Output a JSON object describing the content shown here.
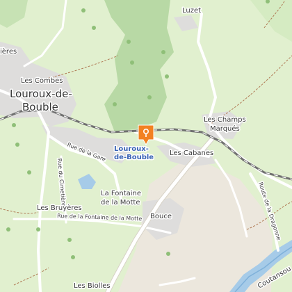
{
  "map": {
    "colors": {
      "meadow": "#e1f0cf",
      "forest": "#b8d9a5",
      "residential": "#e0dfdf",
      "bare": "#ebe6dc",
      "water": "#a6cbe8",
      "rail": "#707070",
      "road": "#ffffff",
      "marker": "#f28122"
    },
    "labels": {
      "louroux_line1": "Louroux-de-",
      "louroux_line2": "Bouble",
      "lieres": "ières",
      "les_combes": "Les Combes",
      "luzet": "Luzet",
      "les_champs_line1": "Les Champs",
      "les_champs_line2": "Marqués",
      "les_cabanes": "Les Cabanes",
      "rue_de_la_gare": "Rue de la Gare",
      "rue_du_cimetiere": "Rue du Cimetière",
      "la_fontaine_line1": "La Fontaine",
      "la_fontaine_line2": "de la Motte",
      "les_bruyeres": "Les Bruyères",
      "rue_fontaine_motte": "Rue de la Fontaine de la Motte",
      "bouce": "Bouce",
      "route_dragonne": "Route de la Dragonne",
      "coutansouze": "Coutansou",
      "les_biolles": "Les Biolles"
    },
    "marker": {
      "label_line1": "Louroux-",
      "label_line2": "de-Bouble",
      "icon": "map-pin-icon"
    }
  }
}
